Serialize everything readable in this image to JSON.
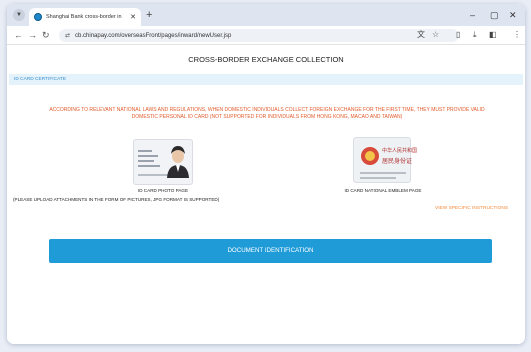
{
  "browser": {
    "tab_title": "Shanghai Bank cross-border in",
    "tab_close": "✕",
    "new_tab": "+",
    "url": "cb.chinapay.com/overseasFront/pages/inward/newUser.jsp",
    "window_controls": {
      "minimize": "–",
      "maximize": "▢",
      "close": "✕"
    },
    "nav": {
      "back": "←",
      "forward": "→",
      "reload": "↻",
      "site_info": "⇄"
    },
    "toolbar_icons": {
      "translate": "文",
      "bookmark": "☆",
      "extensions": "▯",
      "download": "⤓",
      "sidebar": "◧",
      "menu": "⋮"
    }
  },
  "page": {
    "title": "CROSS-BORDER EXCHANGE COLLECTION",
    "section": "ID CARD CERTIFICATE",
    "notice": "ACCORDING TO RELEVANT NATIONAL LAWS AND REGULATIONS, WHEN DOMESTIC INDIVIDUALS COLLECT FOREIGN EXCHANGE FOR THE FIRST TIME, THEY MUST PROVIDE VALID DOMESTIC PERSONAL ID CARD (NOT SUPPORTED FOR INDIVIDUALS FROM HONG KONG, MACAO AND TAIWAN)",
    "photo_page_label": "ID CARD PHOTO PAGE",
    "emblem_page_label": "ID CARD NATIONAL EMBLEM PAGE",
    "upload_note": "(PLEASE UPLOAD ATTACHMENTS IN THE FORM OF PICTURES, JPG FORMAT IS SUPPORTED)",
    "instructions_link": "VIEW SPECIFIC INSTRUCTIONS",
    "button_label": "DOCUMENT IDENTIFICATION",
    "emblem_card_text": {
      "line1": "中华人民共和国",
      "line2": "居民身份证"
    }
  },
  "colors": {
    "accent_blue": "#1f9bd8",
    "notice_red": "#e25b2c",
    "link_orange": "#f08a3a",
    "section_bg": "#e4f2fb"
  }
}
